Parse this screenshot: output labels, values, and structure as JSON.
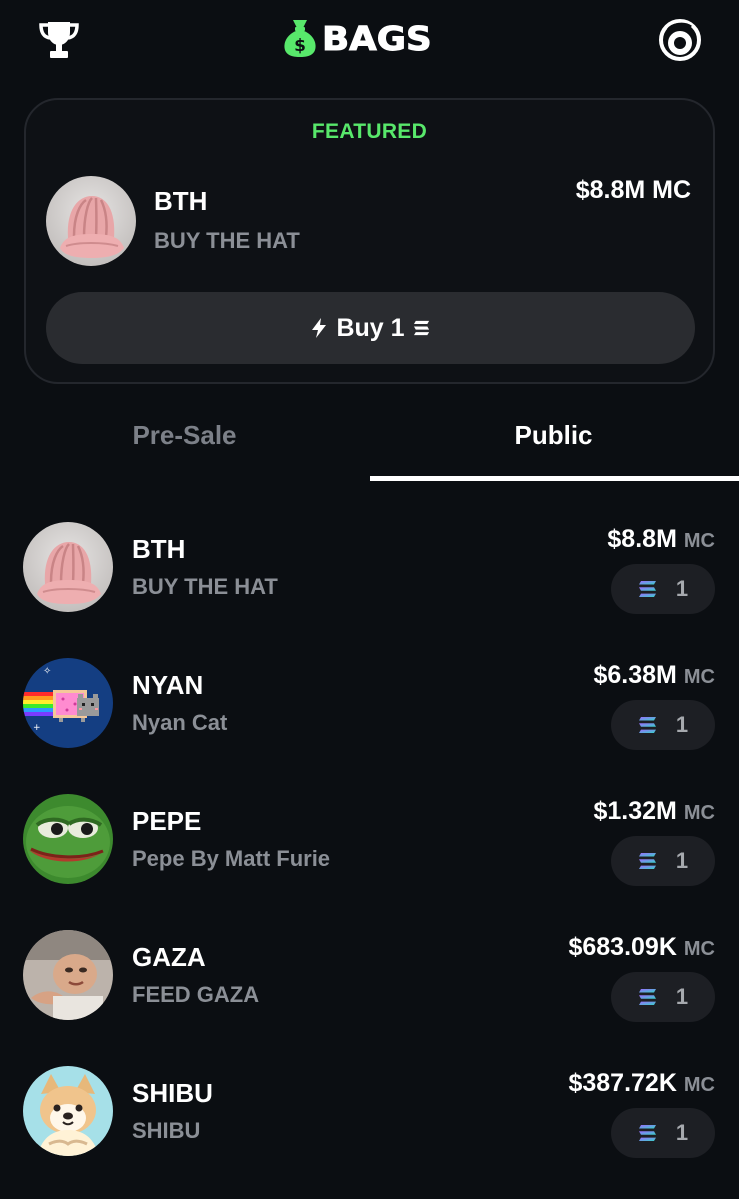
{
  "header": {
    "logo_text": "BAGS",
    "trophy_icon": "trophy-icon",
    "profile_icon": "profile-icon",
    "brand_color": "#58e86b"
  },
  "featured": {
    "label": "FEATURED",
    "ticker": "BTH",
    "name": "BUY THE HAT",
    "market_cap": "$8.8M MC",
    "buy_label": "Buy 1",
    "avatar": "pink-knit-hat"
  },
  "tabs": [
    {
      "label": "Pre-Sale",
      "active": false
    },
    {
      "label": "Public",
      "active": true
    }
  ],
  "tokens": [
    {
      "ticker": "BTH",
      "name": "BUY THE HAT",
      "mc_value": "$8.8M",
      "mc_unit": "MC",
      "amount": "1",
      "avatar": "pink-knit-hat"
    },
    {
      "ticker": "NYAN",
      "name": "Nyan Cat",
      "mc_value": "$6.38M",
      "mc_unit": "MC",
      "amount": "1",
      "avatar": "nyan-cat"
    },
    {
      "ticker": "PEPE",
      "name": "Pepe By Matt Furie",
      "mc_value": "$1.32M",
      "mc_unit": "MC",
      "amount": "1",
      "avatar": "pepe-frog"
    },
    {
      "ticker": "GAZA",
      "name": "FEED GAZA",
      "mc_value": "$683.09K",
      "mc_unit": "MC",
      "amount": "1",
      "avatar": "baby-photo"
    },
    {
      "ticker": "SHIBU",
      "name": "SHIBU",
      "mc_value": "$387.72K",
      "mc_unit": "MC",
      "amount": "1",
      "avatar": "shiba-dog"
    }
  ]
}
